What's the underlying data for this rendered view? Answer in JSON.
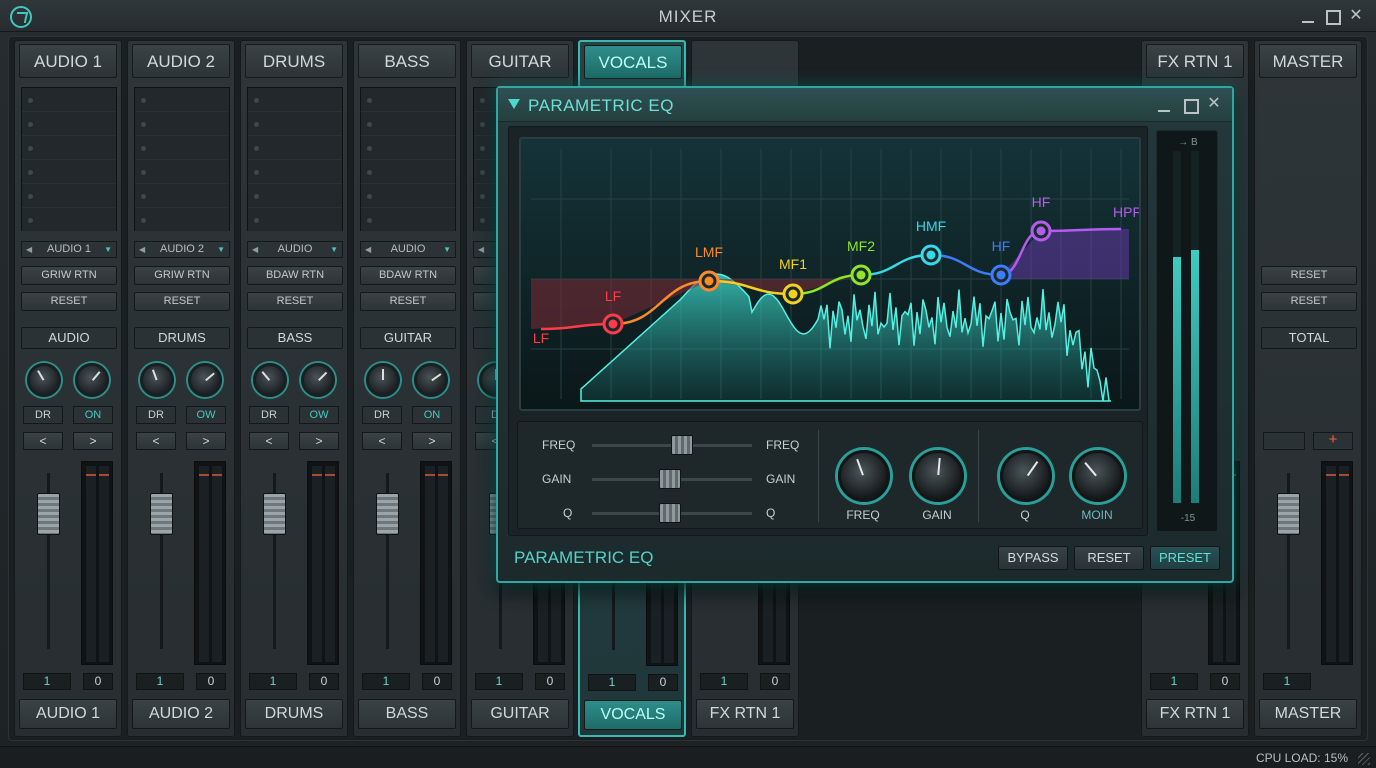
{
  "app": {
    "title": "MIXER",
    "cpu_load": "CPU LOAD: 15%"
  },
  "colors": {
    "accent": "#3bb8b0",
    "background": "#1a1f22",
    "meter_peak": "#a84a36"
  },
  "strips": [
    {
      "header": "AUDIO 1",
      "selector": "AUDIO 1",
      "route": "GRIW RTN",
      "reset": "RESET",
      "name": "AUDIO",
      "dr": "DR",
      "on": "ON",
      "prev": "<",
      "next": ">",
      "num1": "1",
      "num2": "0",
      "footer": "AUDIO 1"
    },
    {
      "header": "AUDIO 2",
      "selector": "AUDIO 2",
      "route": "GRIW RTN",
      "reset": "RESET",
      "name": "DRUMS",
      "dr": "DR",
      "on": "OW",
      "prev": "<",
      "next": ">",
      "num1": "1",
      "num2": "0",
      "footer": "AUDIO 2"
    },
    {
      "header": "DRUMS",
      "selector": "AUDIO",
      "route": "BDAW RTN",
      "reset": "RESET",
      "name": "BASS",
      "dr": "DR",
      "on": "OW",
      "prev": "<",
      "next": ">",
      "num1": "1",
      "num2": "0",
      "footer": "DRUMS"
    },
    {
      "header": "BASS",
      "selector": "AUDIO",
      "route": "BDAW RTN",
      "reset": "RESET",
      "name": "GUITAR",
      "dr": "DR",
      "on": "ON",
      "prev": "<",
      "next": ">",
      "num1": "1",
      "num2": "0",
      "footer": "BASS"
    },
    {
      "header": "GUITAR",
      "num1": "1",
      "num2": "0",
      "footer": "GUITAR",
      "dr": "D",
      "prev": "<",
      "selector": "",
      "route": "G"
    },
    {
      "header": "VOCALS",
      "num1": "1",
      "num2": "0",
      "footer": "VOCALS"
    },
    {
      "num1": "1",
      "num2": "0",
      "footer": "FX RTN 1"
    },
    {
      "header": "FX RTN 1",
      "num1": "1",
      "num2": "0",
      "footer": "FX RTN 1"
    },
    {
      "header": "MASTER",
      "reset1": "RESET",
      "reset2": "RESET",
      "total": "TOTAL",
      "plus": "+",
      "num1": "1",
      "footer": "MASTER"
    }
  ],
  "eq": {
    "title": "PARAMETRIC EQ",
    "footer_title": "PARAMETRIC EQ",
    "bands": [
      {
        "label": "LF",
        "color": "#ff3b4a"
      },
      {
        "label": "LF",
        "color": "#ff3b4a"
      },
      {
        "label": "LMF",
        "color": "#ff8a2a"
      },
      {
        "label": "MF1",
        "color": "#f2d21e"
      },
      {
        "label": "MF2",
        "color": "#8ee62a"
      },
      {
        "label": "HMF",
        "color": "#37d8e8"
      },
      {
        "label": "HF",
        "color": "#3d7cff"
      },
      {
        "label": "HF",
        "color": "#b45cf0"
      },
      {
        "label": "HPF",
        "color": "#b45cf0"
      }
    ],
    "sliders": [
      {
        "left": "FREQ",
        "right": "FREQ",
        "value": 0.56
      },
      {
        "left": "GAIN",
        "right": "GAIN",
        "value": 0.49
      },
      {
        "left": "Q",
        "right": "Q",
        "value": 0.49
      }
    ],
    "knobs": [
      {
        "label": "FREQ",
        "value": -20
      },
      {
        "label": "GAIN",
        "value": 5
      },
      {
        "label": "Q",
        "value": 35
      },
      {
        "label": "MOIN",
        "value": -40
      }
    ],
    "meter": {
      "top_label": "→ B",
      "bottom_label": "-15",
      "levels": [
        0.7,
        0.72
      ]
    },
    "buttons": {
      "bypass": "BYPASS",
      "reset": "RESET",
      "preset": "PRESET"
    }
  }
}
